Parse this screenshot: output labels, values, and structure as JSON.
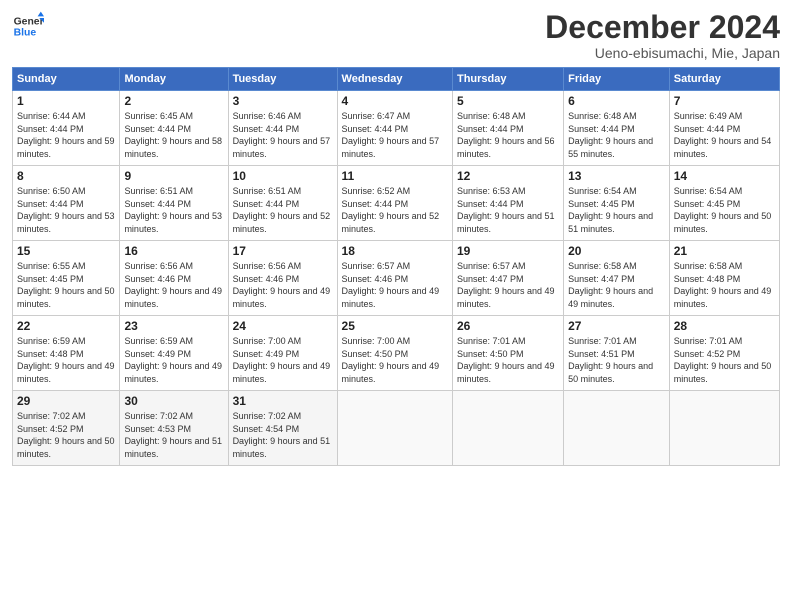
{
  "header": {
    "logo_line1": "General",
    "logo_line2": "Blue",
    "month": "December 2024",
    "location": "Ueno-ebisumachi, Mie, Japan"
  },
  "weekdays": [
    "Sunday",
    "Monday",
    "Tuesday",
    "Wednesday",
    "Thursday",
    "Friday",
    "Saturday"
  ],
  "weeks": [
    [
      {
        "day": "1",
        "rise": "6:44 AM",
        "set": "4:44 PM",
        "daylight": "9 hours and 59 minutes."
      },
      {
        "day": "2",
        "rise": "6:45 AM",
        "set": "4:44 PM",
        "daylight": "9 hours and 58 minutes."
      },
      {
        "day": "3",
        "rise": "6:46 AM",
        "set": "4:44 PM",
        "daylight": "9 hours and 57 minutes."
      },
      {
        "day": "4",
        "rise": "6:47 AM",
        "set": "4:44 PM",
        "daylight": "9 hours and 57 minutes."
      },
      {
        "day": "5",
        "rise": "6:48 AM",
        "set": "4:44 PM",
        "daylight": "9 hours and 56 minutes."
      },
      {
        "day": "6",
        "rise": "6:48 AM",
        "set": "4:44 PM",
        "daylight": "9 hours and 55 minutes."
      },
      {
        "day": "7",
        "rise": "6:49 AM",
        "set": "4:44 PM",
        "daylight": "9 hours and 54 minutes."
      }
    ],
    [
      {
        "day": "8",
        "rise": "6:50 AM",
        "set": "4:44 PM",
        "daylight": "9 hours and 53 minutes."
      },
      {
        "day": "9",
        "rise": "6:51 AM",
        "set": "4:44 PM",
        "daylight": "9 hours and 53 minutes."
      },
      {
        "day": "10",
        "rise": "6:51 AM",
        "set": "4:44 PM",
        "daylight": "9 hours and 52 minutes."
      },
      {
        "day": "11",
        "rise": "6:52 AM",
        "set": "4:44 PM",
        "daylight": "9 hours and 52 minutes."
      },
      {
        "day": "12",
        "rise": "6:53 AM",
        "set": "4:44 PM",
        "daylight": "9 hours and 51 minutes."
      },
      {
        "day": "13",
        "rise": "6:54 AM",
        "set": "4:45 PM",
        "daylight": "9 hours and 51 minutes."
      },
      {
        "day": "14",
        "rise": "6:54 AM",
        "set": "4:45 PM",
        "daylight": "9 hours and 50 minutes."
      }
    ],
    [
      {
        "day": "15",
        "rise": "6:55 AM",
        "set": "4:45 PM",
        "daylight": "9 hours and 50 minutes."
      },
      {
        "day": "16",
        "rise": "6:56 AM",
        "set": "4:46 PM",
        "daylight": "9 hours and 49 minutes."
      },
      {
        "day": "17",
        "rise": "6:56 AM",
        "set": "4:46 PM",
        "daylight": "9 hours and 49 minutes."
      },
      {
        "day": "18",
        "rise": "6:57 AM",
        "set": "4:46 PM",
        "daylight": "9 hours and 49 minutes."
      },
      {
        "day": "19",
        "rise": "6:57 AM",
        "set": "4:47 PM",
        "daylight": "9 hours and 49 minutes."
      },
      {
        "day": "20",
        "rise": "6:58 AM",
        "set": "4:47 PM",
        "daylight": "9 hours and 49 minutes."
      },
      {
        "day": "21",
        "rise": "6:58 AM",
        "set": "4:48 PM",
        "daylight": "9 hours and 49 minutes."
      }
    ],
    [
      {
        "day": "22",
        "rise": "6:59 AM",
        "set": "4:48 PM",
        "daylight": "9 hours and 49 minutes."
      },
      {
        "day": "23",
        "rise": "6:59 AM",
        "set": "4:49 PM",
        "daylight": "9 hours and 49 minutes."
      },
      {
        "day": "24",
        "rise": "7:00 AM",
        "set": "4:49 PM",
        "daylight": "9 hours and 49 minutes."
      },
      {
        "day": "25",
        "rise": "7:00 AM",
        "set": "4:50 PM",
        "daylight": "9 hours and 49 minutes."
      },
      {
        "day": "26",
        "rise": "7:01 AM",
        "set": "4:50 PM",
        "daylight": "9 hours and 49 minutes."
      },
      {
        "day": "27",
        "rise": "7:01 AM",
        "set": "4:51 PM",
        "daylight": "9 hours and 50 minutes."
      },
      {
        "day": "28",
        "rise": "7:01 AM",
        "set": "4:52 PM",
        "daylight": "9 hours and 50 minutes."
      }
    ],
    [
      {
        "day": "29",
        "rise": "7:02 AM",
        "set": "4:52 PM",
        "daylight": "9 hours and 50 minutes."
      },
      {
        "day": "30",
        "rise": "7:02 AM",
        "set": "4:53 PM",
        "daylight": "9 hours and 51 minutes."
      },
      {
        "day": "31",
        "rise": "7:02 AM",
        "set": "4:54 PM",
        "daylight": "9 hours and 51 minutes."
      },
      null,
      null,
      null,
      null
    ]
  ],
  "labels": {
    "sunrise": "Sunrise:",
    "sunset": "Sunset:",
    "daylight": "Daylight:"
  }
}
